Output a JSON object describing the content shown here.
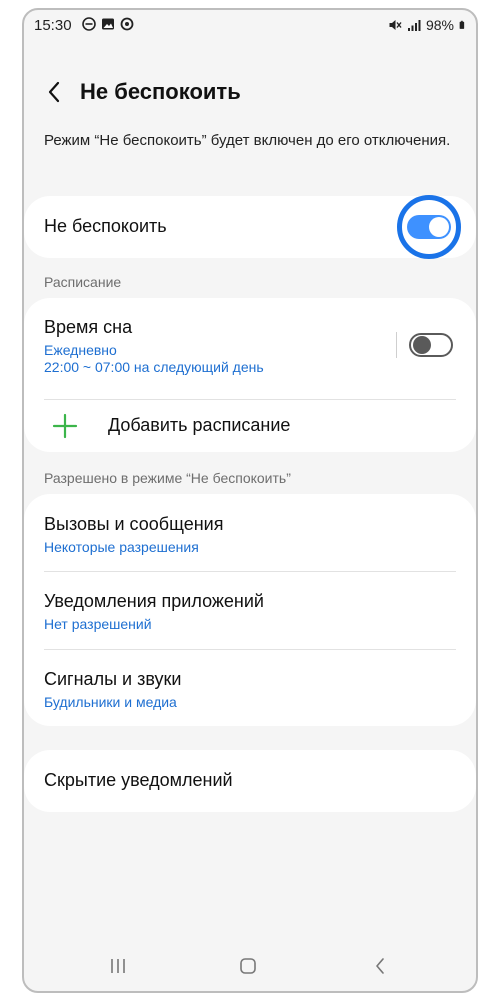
{
  "status_bar": {
    "time": "15:30",
    "battery": "98%",
    "left_icons": [
      "do-not-disturb-icon",
      "image-icon",
      "data-saver-icon"
    ],
    "right_icons": [
      "mute-icon",
      "signal-icon",
      "battery-icon"
    ]
  },
  "header": {
    "title": "Не беспокоить"
  },
  "description": "Режим “Не беспокоить” будет включен до его отключения.",
  "dnd_toggle": {
    "label": "Не беспокоить",
    "state": "on"
  },
  "schedule": {
    "section_label": "Расписание",
    "items": [
      {
        "title": "Время сна",
        "sub1": "Ежедневно",
        "sub2": "22:00 ~ 07:00 на следующий день",
        "state": "off"
      }
    ],
    "add_label": "Добавить расписание"
  },
  "allowed": {
    "section_label": "Разрешено в режиме “Не беспокоить”",
    "items": [
      {
        "title": "Вызовы и сообщения",
        "sub": "Некоторые разрешения"
      },
      {
        "title": "Уведомления приложений",
        "sub": "Нет разрешений"
      },
      {
        "title": "Сигналы и звуки",
        "sub": "Будильники и медиа"
      }
    ]
  },
  "hide_notifications": {
    "title": "Скрытие уведомлений"
  },
  "colors": {
    "accent": "#3e91ff",
    "highlight": "#1a73e8",
    "link": "#1e6fd1",
    "add_icon": "#3bb54a"
  }
}
